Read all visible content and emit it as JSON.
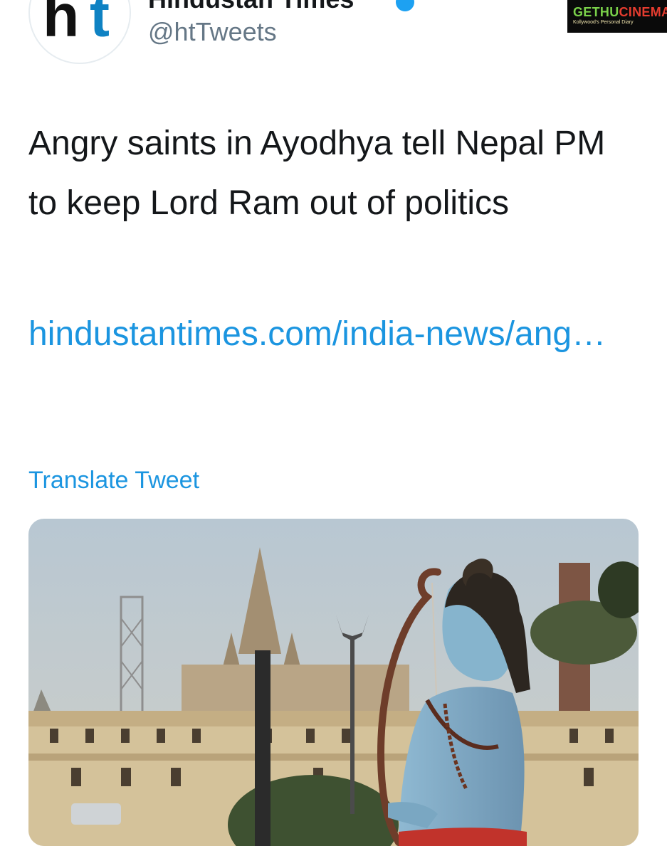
{
  "tweet": {
    "author": {
      "display_name": "Hindustan Times",
      "handle": "@htTweets",
      "avatar_text": {
        "left": "h",
        "right": "t"
      },
      "verified": true,
      "verified_icon": "verified-badge-icon"
    },
    "text": "Angry saints in Ayodhya tell Nepal PM to keep Lord Ram out of politics",
    "link": "hindustantimes.com/india-news/ang…",
    "translate_label": "Translate Tweet",
    "media": {
      "kind": "photo"
    }
  },
  "watermark": {
    "part1": "GETHU",
    "part2": "CINEMA",
    "tagline": "Kollywood's Personal Diary"
  },
  "colors": {
    "link": "#1b95e0",
    "text": "#14171a",
    "handle": "#657786",
    "verified": "#1da1f2",
    "avatar_t": "#0f82c3"
  }
}
